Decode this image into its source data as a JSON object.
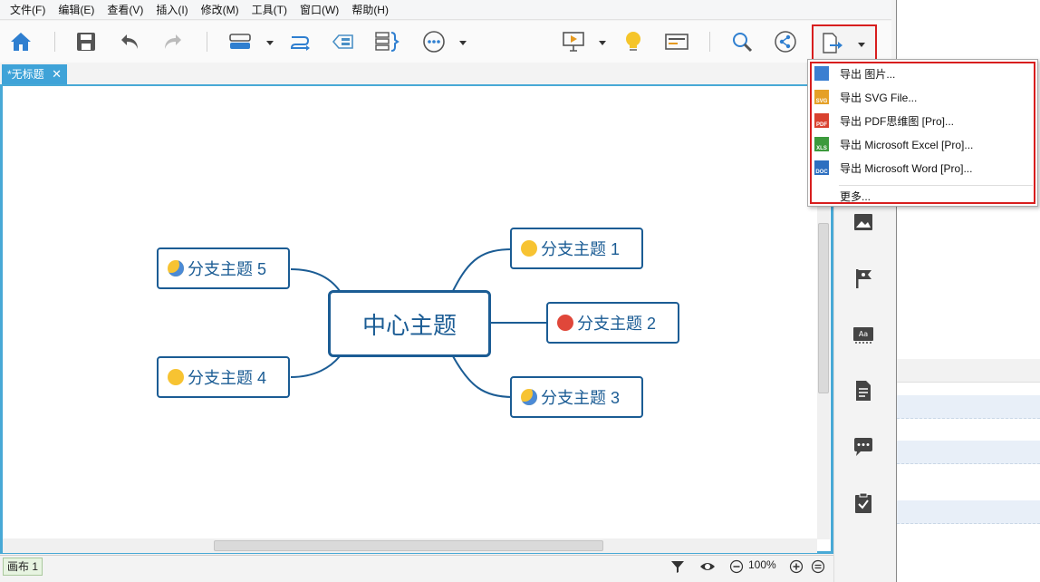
{
  "menubar": {
    "items": [
      "文件(F)",
      "编辑(E)",
      "查看(V)",
      "插入(I)",
      "修改(M)",
      "工具(T)",
      "窗口(W)",
      "帮助(H)"
    ]
  },
  "tab": {
    "title": "*无标题",
    "close": "✕"
  },
  "map": {
    "central": "中心主题",
    "branches": [
      {
        "label": "分支主题 1",
        "emoji": "smile"
      },
      {
        "label": "分支主题 2",
        "emoji": "angry"
      },
      {
        "label": "分支主题 3",
        "emoji": "cry"
      },
      {
        "label": "分支主题 4",
        "emoji": "neutral"
      },
      {
        "label": "分支主题 5",
        "emoji": "cry"
      }
    ]
  },
  "export_menu": {
    "items": [
      {
        "label": "导出 图片...",
        "badge": "",
        "color": "#3b7fd1"
      },
      {
        "label": "导出 SVG File...",
        "badge": "SVG",
        "color": "#e5a027"
      },
      {
        "label": "导出 PDF思维图 [Pro]...",
        "badge": "PDF",
        "color": "#d9412f"
      },
      {
        "label": "导出 Microsoft Excel [Pro]...",
        "badge": "XLS",
        "color": "#3c9a3c"
      },
      {
        "label": "导出 Microsoft Word [Pro]...",
        "badge": "DOC",
        "color": "#2d6fc0"
      }
    ],
    "more": "更多..."
  },
  "statusbar": {
    "sheet": "画布 1",
    "zoom": "100%"
  },
  "colors": {
    "accent": "#48a9d6",
    "topic": "#1b5c94",
    "highlight": "#d81e1e"
  }
}
